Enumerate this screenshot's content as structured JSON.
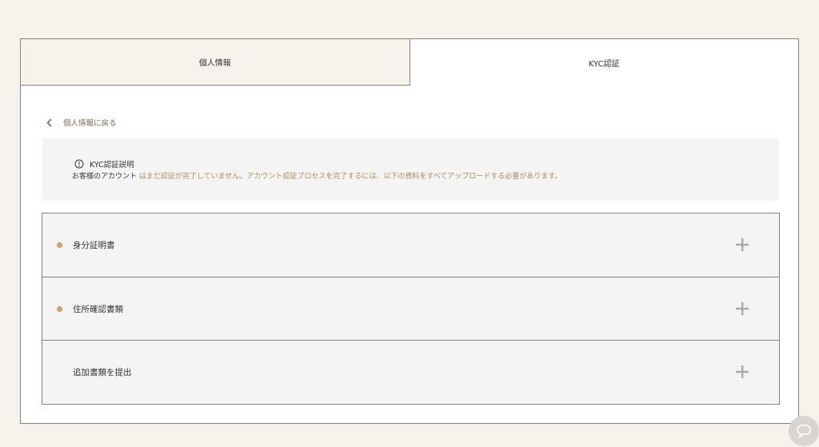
{
  "colors": {
    "page_bg": "#f6f2ec",
    "accent": "#c9a46a",
    "highlight": "#a88b63"
  },
  "tabs": [
    {
      "label": "個人情報",
      "state": "inactive"
    },
    {
      "label": "KYC認証",
      "state": "active"
    }
  ],
  "back_link": {
    "label": "個人情報に戻る",
    "icon": "chevron-left-icon"
  },
  "notice": {
    "icon": "info-circle-icon",
    "title": "KYC認証説明",
    "body_prefix": "お客様のアカウント",
    "body_highlight": "はまだ認証が完了していません。アカウント認証プロセスを完了するには、以下の資料をすべてアップロードする必要があります。"
  },
  "sections": [
    {
      "label": "身分証明書",
      "required": true
    },
    {
      "label": "住所確認書類",
      "required": true
    },
    {
      "label": "追加書類を提出",
      "required": false
    }
  ],
  "chat": {
    "icon": "chat-bubble-icon"
  }
}
